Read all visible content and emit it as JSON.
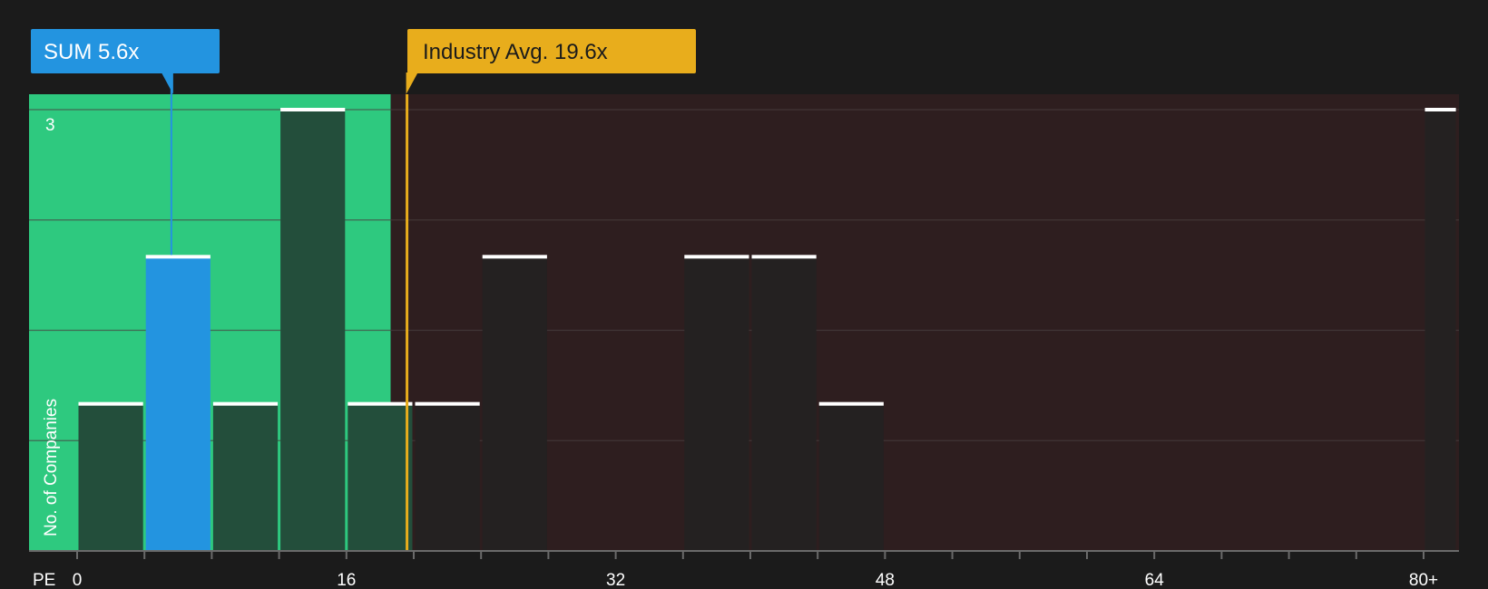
{
  "colors": {
    "background": "#1b1b1b",
    "under_zone": "#2ec97f",
    "over_zone": "#2e1e1f",
    "bar_under": "#234e3b",
    "bar_over": "#242121",
    "company": "#2394e0",
    "industry": "#e8ad1c",
    "bar_cap": "#ffffff",
    "grid": "#4a4040",
    "axis": "#6a6a6a"
  },
  "chart_data": {
    "type": "bar",
    "xlabel": "PE",
    "ylabel": "No. of Companies",
    "x_ticks": [
      "0",
      "16",
      "32",
      "48",
      "64",
      "80+"
    ],
    "x_tick_values": [
      0,
      16,
      32,
      48,
      64,
      80
    ],
    "xlim": [
      0,
      82
    ],
    "y_ticks": [
      "3"
    ],
    "ylim": [
      0,
      3.1
    ],
    "bin_width": 4,
    "bins": [
      {
        "start": 0,
        "end": 4,
        "count": 1
      },
      {
        "start": 4,
        "end": 8,
        "count": 2,
        "highlight": true
      },
      {
        "start": 8,
        "end": 12,
        "count": 1
      },
      {
        "start": 12,
        "end": 16,
        "count": 3
      },
      {
        "start": 16,
        "end": 20,
        "count": 1
      },
      {
        "start": 20,
        "end": 24,
        "count": 1
      },
      {
        "start": 24,
        "end": 28,
        "count": 2
      },
      {
        "start": 36,
        "end": 40,
        "count": 2
      },
      {
        "start": 40,
        "end": 44,
        "count": 2
      },
      {
        "start": 44,
        "end": 48,
        "count": 1
      },
      {
        "start": 80,
        "end": 82,
        "count": 3
      }
    ],
    "company": {
      "label": "SUM 5.6x",
      "value": 5.6
    },
    "industry": {
      "label": "Industry Avg. 19.6x",
      "value": 19.6
    }
  }
}
